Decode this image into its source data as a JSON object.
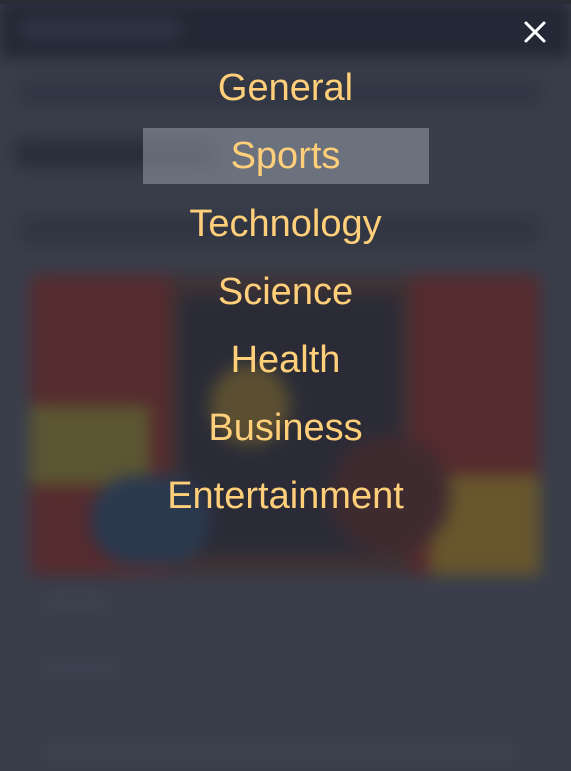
{
  "close": {
    "icon": "close-icon",
    "color": "#ffffff"
  },
  "menu": {
    "accent_color": "#ffcf7a",
    "active_index": 1,
    "items": [
      {
        "label": "General"
      },
      {
        "label": "Sports"
      },
      {
        "label": "Technology"
      },
      {
        "label": "Science"
      },
      {
        "label": "Health"
      },
      {
        "label": "Business"
      },
      {
        "label": "Entertainment"
      }
    ]
  }
}
